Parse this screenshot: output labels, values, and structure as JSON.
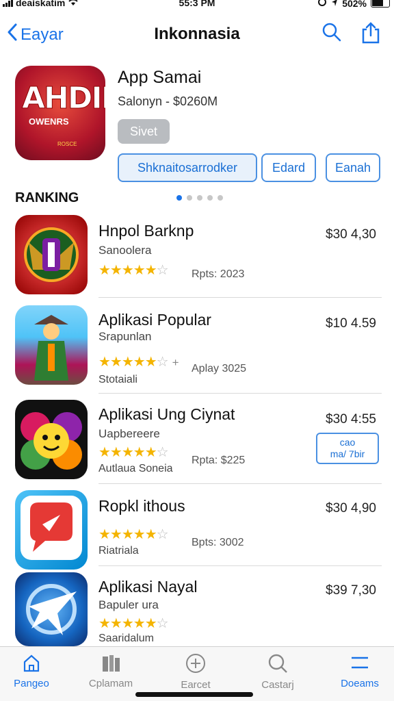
{
  "status_bar": {
    "carrier": "deaískatim",
    "time": "55:3 PM",
    "battery": "502%"
  },
  "nav": {
    "back_label": "Eayar",
    "title": "Inkonnasia"
  },
  "hero": {
    "icon_text": "AHDIK",
    "icon_subtext": "OWENRS",
    "icon_tiny": "ROSCE",
    "app_name": "App Samai",
    "subtitle": "Salonyn - $0260M",
    "get_label": "Sivet",
    "buttons": [
      "Shknaitosarrodker",
      "Edard",
      "Eanah"
    ]
  },
  "section": {
    "title": "RANKING",
    "page_count": 5,
    "active_page": 1
  },
  "apps": [
    {
      "title": "Hnpol Barknp",
      "subtitle": "Sanoolera",
      "rating": 4.5,
      "meta": "Rpts: 2023",
      "price": "$30 4,30",
      "extra": "",
      "badge": [],
      "icon": "medal-icon"
    },
    {
      "title": "Aplikasi Popular",
      "subtitle": "Srapunlan",
      "rating": 4.5,
      "meta": "Aplay 3025",
      "price": "$10 4.59",
      "extra": "Stotaiali",
      "badge": [],
      "plus": "+",
      "icon": "warrior-icon"
    },
    {
      "title": "Aplikasi Ung Ciynat",
      "subtitle": "Uapbereere",
      "rating": 4.5,
      "meta": "Rpta: $225",
      "price": "$30 4:55",
      "extra": "Autlaua Soneia",
      "badge": [
        "cao",
        "ma/ 7bir"
      ],
      "icon": "flower-face-icon"
    },
    {
      "title": "Ropkl ithous",
      "subtitle": "",
      "rating": 4.5,
      "meta": "Bpts: 3002",
      "price": "$30 4,90",
      "extra": "Riatriala",
      "badge": [],
      "icon": "play-chat-icon"
    },
    {
      "title": "Aplikasi Nayal",
      "subtitle": "Bapuler ura",
      "rating": 4.5,
      "meta": "",
      "price": "$39 7,30",
      "extra": "Saaridalum",
      "badge": [],
      "icon": "star-swirl-icon"
    }
  ],
  "tabs": [
    {
      "label": "Pangeo",
      "icon": "home-icon",
      "active": true
    },
    {
      "label": "Cplamam",
      "icon": "books-icon",
      "active": false
    },
    {
      "label": "Earcet",
      "icon": "add-circle-icon",
      "active": false
    },
    {
      "label": "Castarj",
      "icon": "search-icon",
      "active": false
    },
    {
      "label": "Doeams",
      "icon": "list-icon",
      "active": true
    }
  ],
  "colors": {
    "accent": "#1a73e8",
    "star": "#f4b400",
    "hero_icon": "#b0152a"
  }
}
